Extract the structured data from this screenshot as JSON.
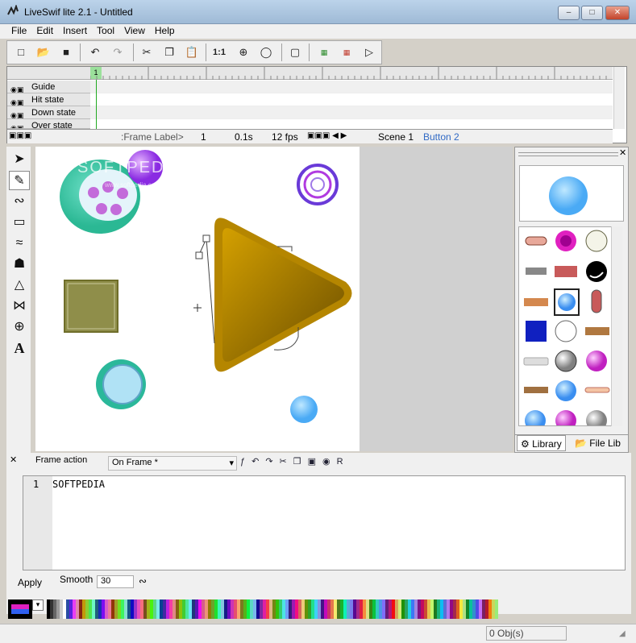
{
  "window": {
    "title": "LiveSwif lite 2.1  - Untitled",
    "minimize": "–",
    "maximize": "□",
    "close": "✕"
  },
  "menu": [
    "File",
    "Edit",
    "Insert",
    "Tool",
    "View",
    "Help"
  ],
  "toolbar": {
    "zoom_actual": "1:1"
  },
  "timeline": {
    "frame_number": "1",
    "layers": [
      "Guide",
      "Hit state",
      "Down state",
      "Over state"
    ],
    "frame_label": ":Frame Label>",
    "current_frame": "1",
    "time": "0.1s",
    "fps": "12 fps",
    "tabs": [
      "Scene 1",
      "Button 2"
    ]
  },
  "stage": {
    "watermark": "SOFTPEDIA",
    "watermark_sub": "www.softpedia.com"
  },
  "library": {
    "tabs": [
      "Library",
      "File Lib"
    ]
  },
  "action": {
    "label": "Frame action",
    "event": "On Frame *",
    "line_number": "1",
    "code": "SOFTPEDIA",
    "apply": "Apply",
    "smooth_label": "Smooth",
    "smooth_value": "30"
  },
  "status": {
    "objects": "0 Obj(s)"
  },
  "colors": {
    "accent": "#316ac5",
    "stage_bg": "#ffffff",
    "play_fill": "#b58600"
  }
}
